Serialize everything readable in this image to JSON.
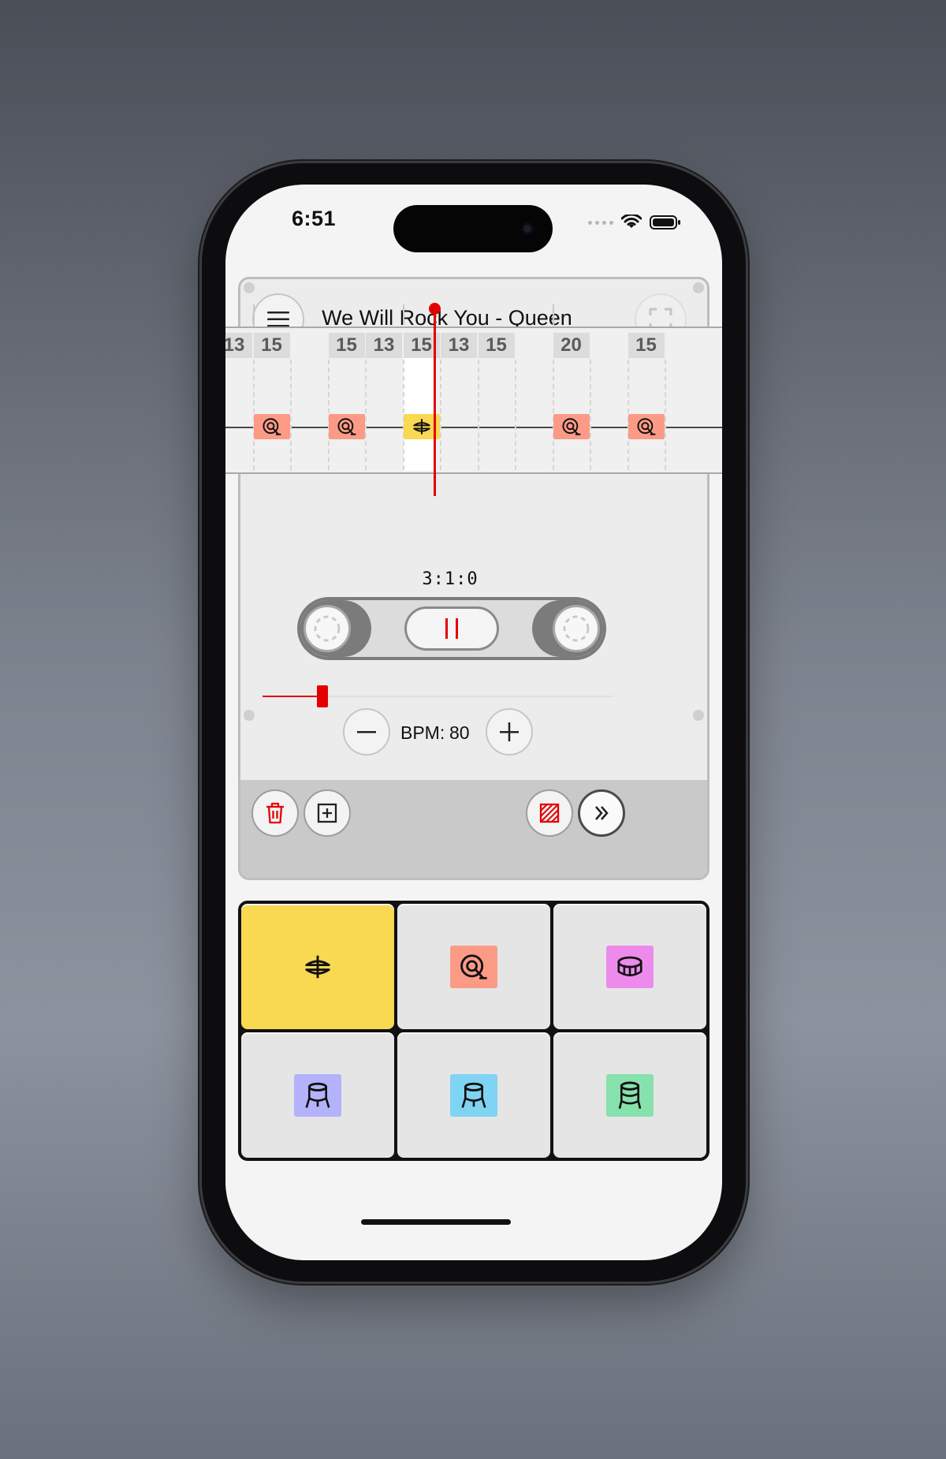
{
  "status_bar": {
    "time": "6:51"
  },
  "header": {
    "song_title": "We Will Rock You - Queen"
  },
  "timeline": {
    "columns": [
      {
        "label": "13",
        "note": null
      },
      {
        "label": "15",
        "note": "kick"
      },
      {
        "label": "",
        "note": null
      },
      {
        "label": "15",
        "note": "kick"
      },
      {
        "label": "13",
        "note": null
      },
      {
        "label": "15",
        "note": "hihat",
        "current": true
      },
      {
        "label": "13",
        "note": null
      },
      {
        "label": "15",
        "note": null
      },
      {
        "label": "",
        "note": null
      },
      {
        "label": "20",
        "note": "kick"
      },
      {
        "label": "",
        "note": null
      },
      {
        "label": "15",
        "note": "kick"
      }
    ],
    "position": "3:1:0"
  },
  "transport": {
    "state": "playing",
    "button": "pause-icon"
  },
  "seek": {
    "progress_fraction": 0.17
  },
  "tempo": {
    "bpm_label": "BPM:",
    "bpm_value": "80"
  },
  "toolbar": {
    "left": [
      "trash-icon",
      "add-box-icon"
    ],
    "right": [
      "hatch-pattern-icon",
      "double-chevron-right-icon"
    ]
  },
  "pads": [
    {
      "instrument": "hihat",
      "icon": "hihat-icon",
      "color": "#f9d852",
      "active": true
    },
    {
      "instrument": "kick",
      "icon": "kick-drum-icon",
      "color": "#fb9b86",
      "active": false
    },
    {
      "instrument": "snare",
      "icon": "snare-drum-icon",
      "color": "#ed8bec",
      "active": false
    },
    {
      "instrument": "tom-1",
      "icon": "tom-drum-icon",
      "color": "#b4b2fa",
      "active": false
    },
    {
      "instrument": "tom-2",
      "icon": "tom-drum-icon",
      "color": "#7fd3f3",
      "active": false
    },
    {
      "instrument": "floor-tom",
      "icon": "floor-tom-icon",
      "color": "#86e1ad",
      "active": false
    }
  ],
  "colors": {
    "accent": "#e40000",
    "kick": "#fb9b86",
    "hihat": "#f9d852"
  }
}
